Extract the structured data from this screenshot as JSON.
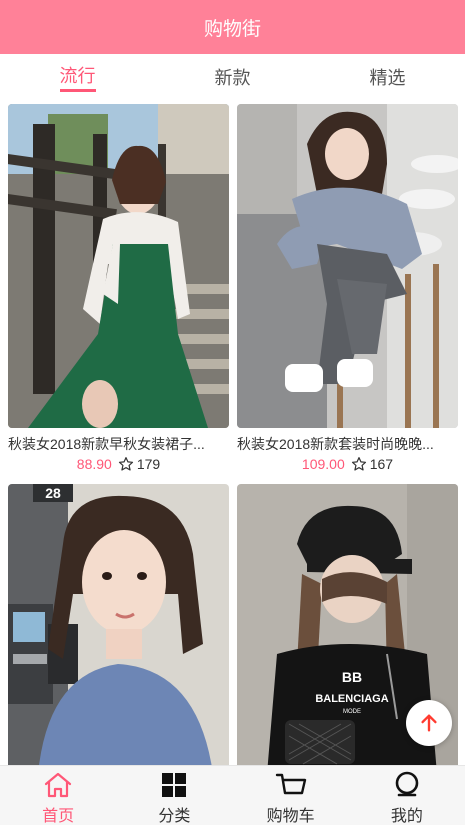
{
  "navbar": {
    "title": "购物街"
  },
  "tabs": [
    {
      "label": "流行",
      "active": true
    },
    {
      "label": "新款",
      "active": false
    },
    {
      "label": "精选",
      "active": false
    }
  ],
  "goods": [
    {
      "name": "秋装女2018新款早秋女装裙子...",
      "price": "88.90",
      "favorites": "179"
    },
    {
      "name": "秋装女2018新款套装时尚晚晚...",
      "price": "109.00",
      "favorites": "167"
    },
    {
      "name": "",
      "price": "",
      "favorites": ""
    },
    {
      "name": "",
      "price": "",
      "favorites": ""
    }
  ],
  "photo_text": {
    "sign_number": "28",
    "shirt_brand": "BALENCIAGA",
    "shirt_sub": "MODE",
    "shirt_logo": "BB"
  },
  "tabbar": [
    {
      "label": "首页",
      "icon": "home-icon",
      "active": true
    },
    {
      "label": "分类",
      "icon": "category-icon",
      "active": false
    },
    {
      "label": "购物车",
      "icon": "cart-icon",
      "active": false
    },
    {
      "label": "我的",
      "icon": "profile-icon",
      "active": false
    }
  ],
  "colors": {
    "navbar": "#ff8198",
    "accent": "#ff5777"
  }
}
